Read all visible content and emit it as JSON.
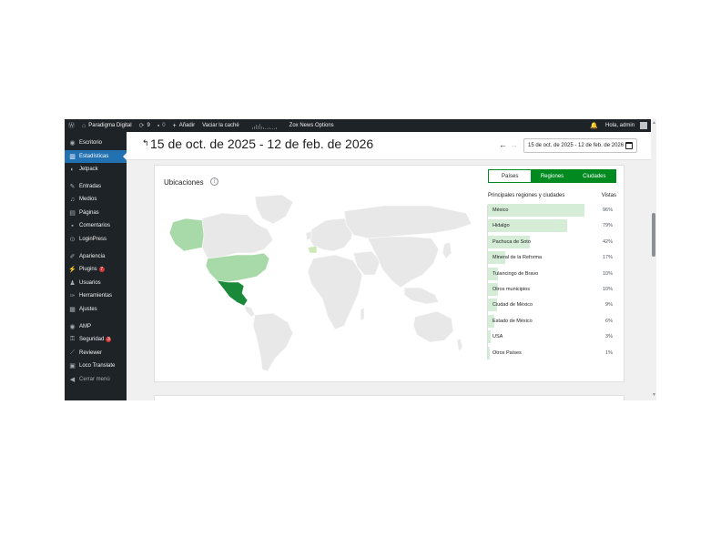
{
  "admin_bar": {
    "site_name": "Paradigma Digital",
    "updates_count": "9",
    "comments_count": "0",
    "new_label": "Añadir",
    "cache_label": "Vaciar la caché",
    "zox_label": "Zox News Options",
    "greeting": "Hola, admin"
  },
  "sidebar": {
    "items": [
      {
        "label": "Escritorio",
        "icon": "dashboard-icon"
      },
      {
        "label": "Estadísticas",
        "icon": "stats-icon"
      },
      {
        "label": "Jetpack",
        "icon": "jetpack-icon"
      },
      {
        "label": "Entradas",
        "icon": "pin-icon"
      },
      {
        "label": "Medios",
        "icon": "media-icon"
      },
      {
        "label": "Páginas",
        "icon": "pages-icon"
      },
      {
        "label": "Comentarios",
        "icon": "comment-icon"
      },
      {
        "label": "LoginPress",
        "icon": "loginpress-icon"
      },
      {
        "label": "Apariencia",
        "icon": "brush-icon"
      },
      {
        "label": "Plugins",
        "icon": "plugin-icon",
        "badge": "7"
      },
      {
        "label": "Usuarios",
        "icon": "users-icon"
      },
      {
        "label": "Herramientas",
        "icon": "wrench-icon"
      },
      {
        "label": "Ajustes",
        "icon": "settings-icon"
      },
      {
        "label": "AMP",
        "icon": "amp-icon"
      },
      {
        "label": "Seguridad",
        "icon": "lock-icon",
        "badge": "3"
      },
      {
        "label": "Reviewer",
        "icon": "reviewer-icon"
      },
      {
        "label": "Loco Translate",
        "icon": "translate-icon"
      },
      {
        "label": "Cerrar menú",
        "icon": "collapse-icon"
      }
    ]
  },
  "header": {
    "back_icon": "↰",
    "date_range_title": "15 de oct. de 2025 - 12 de feb. de 2026",
    "picker_value": "15 de oct. de 2025 - 12 de feb. de 2026"
  },
  "locations": {
    "title": "Ubicaciones",
    "info_icon": "i",
    "tabs": [
      "Países",
      "Regiones",
      "Ciudades"
    ],
    "selected_tab": "Regiones",
    "table_header_left": "Principales regiones y ciudades",
    "table_header_right": "Vistas",
    "rows": [
      {
        "label": "México",
        "percent": "96%",
        "fraction": 0.96
      },
      {
        "label": "Hidalgo",
        "percent": "79%",
        "fraction": 0.79
      },
      {
        "label": "Pachuca de Soto",
        "percent": "42%",
        "fraction": 0.42
      },
      {
        "label": "Mineral de la Reforma",
        "percent": "17%",
        "fraction": 0.17
      },
      {
        "label": "Tulancingo de Bravo",
        "percent": "10%",
        "fraction": 0.1
      },
      {
        "label": "Otros municipios",
        "percent": "10%",
        "fraction": 0.1
      },
      {
        "label": "Ciudad de México",
        "percent": "9%",
        "fraction": 0.09
      },
      {
        "label": "Estado de México",
        "percent": "6%",
        "fraction": 0.06
      },
      {
        "label": "USA",
        "percent": "3%",
        "fraction": 0.03
      },
      {
        "label": "Otros Países",
        "percent": "1%",
        "fraction": 0.01
      }
    ]
  },
  "colors": {
    "accent_green": "#008a20",
    "bar_green": "#d5ecd7",
    "mexico_green": "#1a8a3a",
    "usa_green": "#a8d9a8",
    "map_gray": "#e8e8e8",
    "admin_blue": "#2271b1"
  }
}
